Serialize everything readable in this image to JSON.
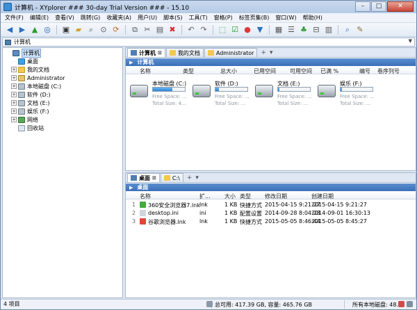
{
  "window": {
    "title": "计算机 - XYplorer ### 30-day Trial Version ### - 15.10",
    "min_label": "–",
    "max_label": "□",
    "close_label": "✕"
  },
  "menu": [
    "文件(F)",
    "编辑(E)",
    "查看(V)",
    "跳转(G)",
    "收藏夹(A)",
    "用户(U)",
    "脚本(S)",
    "工具(T)",
    "窗格(P)",
    "标签页集(B)",
    "窗口(W)",
    "帮助(H)"
  ],
  "address": {
    "value": "计算机"
  },
  "tree": [
    {
      "label": "计算机",
      "icon": "computer-icon",
      "exp": "",
      "indent": 0,
      "selected": true
    },
    {
      "label": "桌面",
      "icon": "desktop-icon",
      "exp": "",
      "indent": 1
    },
    {
      "label": "我的文档",
      "icon": "folder-icon",
      "exp": "+",
      "indent": 1
    },
    {
      "label": "Administrator",
      "icon": "user-folder-icon",
      "exp": "+",
      "indent": 1
    },
    {
      "label": "本地磁盘 (C:)",
      "icon": "drive-icon",
      "exp": "+",
      "indent": 1
    },
    {
      "label": "软件 (D:)",
      "icon": "drive-icon",
      "exp": "+",
      "indent": 1
    },
    {
      "label": "文档 (E:)",
      "icon": "drive-icon",
      "exp": "+",
      "indent": 1
    },
    {
      "label": "娱乐 (F:)",
      "icon": "drive-icon",
      "exp": "+",
      "indent": 1
    },
    {
      "label": "网络",
      "icon": "network-icon",
      "exp": "+",
      "indent": 1
    },
    {
      "label": "回收站",
      "icon": "recycle-bin-icon",
      "exp": "",
      "indent": 1
    }
  ],
  "top_pane": {
    "tabs": [
      {
        "label": "计算机",
        "active": true
      },
      {
        "label": "我的文档",
        "active": false
      },
      {
        "label": "Administrator",
        "active": false
      }
    ],
    "add_tab": "+",
    "tab_menu": "▾",
    "location": "计算机",
    "columns": [
      "名称",
      "类型",
      "总大小",
      "已用空间",
      "可用空间",
      "已满 %",
      "编号",
      "卷序列号"
    ],
    "drives": [
      {
        "name": "本地磁盘 (C:)",
        "free": "Free Space: ...",
        "total": "Total Size: 4...",
        "used_fraction": 0.6
      },
      {
        "name": "软件 (D:)",
        "free": "Free Space: ...",
        "total": "Total Size: ...",
        "used_fraction": 0.1
      },
      {
        "name": "文档 (E:)",
        "free": "Free Space: ...",
        "total": "Total Size: ...",
        "used_fraction": 0.05
      },
      {
        "name": "娱乐 (F:)",
        "free": "Free Space: ...",
        "total": "Total Size: ...",
        "used_fraction": 0.05
      }
    ]
  },
  "bottom_pane": {
    "tabs": [
      {
        "label": "桌面",
        "active": true
      },
      {
        "label": "C:\\",
        "active": false
      }
    ],
    "add_tab": "+",
    "tab_menu": "▾",
    "location": "桌面",
    "columns": [
      "名称",
      "扩...",
      "大小",
      "类型",
      "修改日期",
      "创建日期"
    ],
    "files": [
      {
        "num": "1",
        "name": "360安全浏览器7.lnk",
        "ext": "lnk",
        "size": "1 KB",
        "type": "快捷方式",
        "modified": "2015-04-15 9:21:27",
        "created": "2015-04-15 9:21:27",
        "icon": "browser-360-icon"
      },
      {
        "num": "2",
        "name": "desktop.ini",
        "ext": "ini",
        "size": "1 KB",
        "type": "配置设置",
        "modified": "2014-09-28 8:04:28",
        "created": "2014-09-01 16:30:13",
        "icon": "ini-file-icon"
      },
      {
        "num": "3",
        "name": "谷歌浏览器.lnk",
        "ext": "lnk",
        "size": "1 KB",
        "type": "快捷方式",
        "modified": "2015-05-05 8:46:44",
        "created": "2015-05-05 8:45:27",
        "icon": "chrome-icon"
      }
    ]
  },
  "status": {
    "left": "4 项目",
    "middle": "总可用: 417.39 GB, 容量: 465.76 GB",
    "right": "所有本地磁盘: 48..."
  },
  "colors": {
    "accent": "#3a6fb9",
    "drive_fill": "#2c86d6"
  }
}
